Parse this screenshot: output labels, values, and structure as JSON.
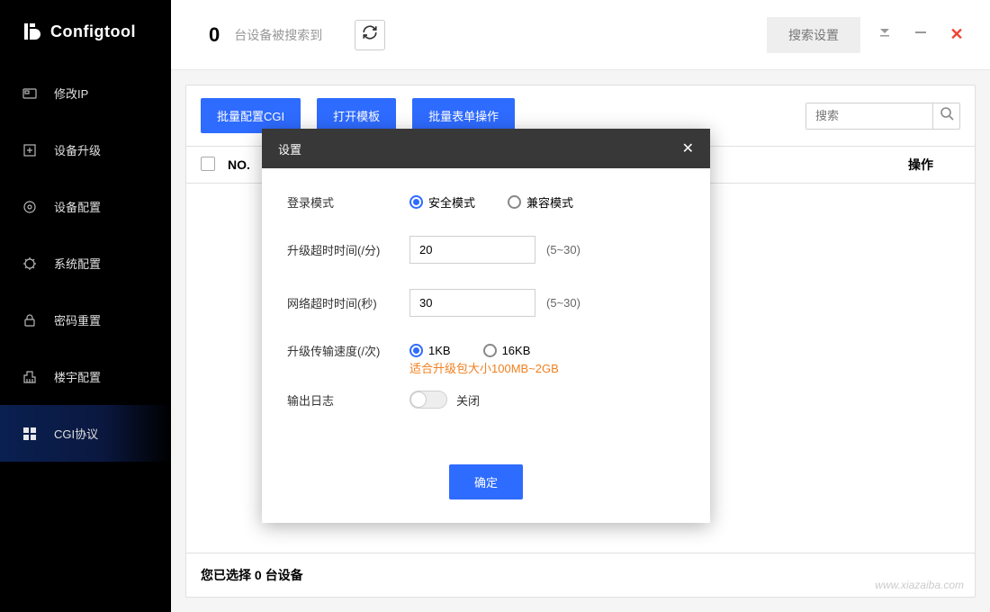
{
  "brand": {
    "name": "Configtool"
  },
  "sidebar": {
    "items": [
      {
        "label": "修改IP"
      },
      {
        "label": "设备升级"
      },
      {
        "label": "设备配置"
      },
      {
        "label": "系统配置"
      },
      {
        "label": "密码重置"
      },
      {
        "label": "楼宇配置"
      },
      {
        "label": "CGI协议"
      }
    ],
    "active_index": 6
  },
  "topbar": {
    "count": "0",
    "count_label": "台设备被搜索到",
    "search_settings": "搜索设置"
  },
  "toolbar": {
    "batch_cgi": "批量配置CGI",
    "open_template": "打开模板",
    "batch_form": "批量表单操作",
    "search_placeholder": "搜索"
  },
  "table": {
    "col_no": "NO.",
    "col_op": "操作"
  },
  "footer": {
    "selected_prefix": "您已选择 ",
    "selected_count": "0",
    "selected_suffix": " 台设备"
  },
  "modal": {
    "title": "设置",
    "login_mode_label": "登录模式",
    "login_mode_options": {
      "safe": "安全模式",
      "compat": "兼容模式"
    },
    "login_mode_selected": "safe",
    "upgrade_timeout_label": "升级超时时间(/分)",
    "upgrade_timeout_value": "20",
    "upgrade_timeout_hint": "(5~30)",
    "network_timeout_label": "网络超时时间(秒)",
    "network_timeout_value": "30",
    "network_timeout_hint": "(5~30)",
    "speed_label": "升级传输速度(/次)",
    "speed_options": {
      "k1": "1KB",
      "k16": "16KB"
    },
    "speed_selected": "k1",
    "speed_hint": "适合升级包大小100MB~2GB",
    "log_label": "输出日志",
    "log_toggle_state": "关闭",
    "confirm": "确定"
  },
  "watermark": "www.xiazaiba.com"
}
